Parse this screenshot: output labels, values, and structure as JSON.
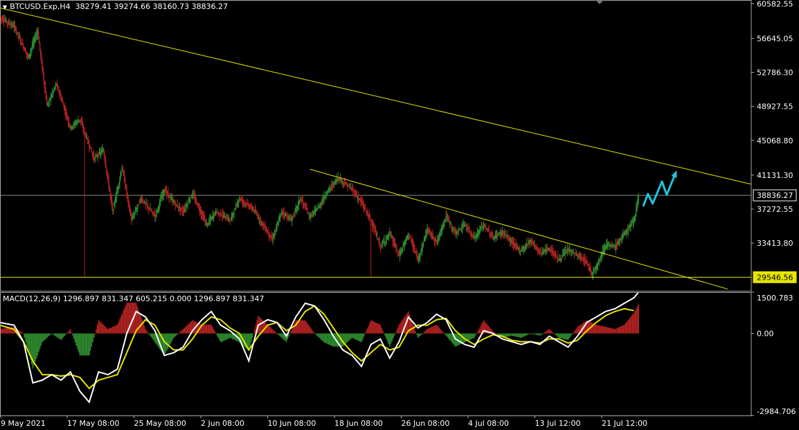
{
  "header": {
    "symbol": "BTCUSD.Exp,H4",
    "ohlc": "38279.41 39274.66 38160.73 38836.27"
  },
  "macd_header": "MACD(12,26,9) 1296.897 831.347 605.215 0.000 1296.897 831.347",
  "colors": {
    "background": "#000000",
    "bull": "#2e8b2e",
    "bear": "#b22222",
    "trendline": "#e6e600",
    "arrow": "#1fc4d8",
    "macd_line": "#ffffff",
    "signal_line": "#e6e600"
  },
  "chart_data": [
    {
      "type": "candlestick",
      "price_ticks": [
        "60582.55",
        "56645.05",
        "52786.30",
        "48927.55",
        "45068.80",
        "41131.30",
        "37272.55",
        "33413.80"
      ],
      "current_price_label": "38836.27",
      "support_label": "29546.56",
      "time_ticks": [
        "9 May 2021",
        "17 May 08:00",
        "25 May 08:00",
        "2 Jun 08:00",
        "10 Jun 08:00",
        "18 Jun 08:00",
        "26 Jun 08:00",
        "4 Jul 08:00",
        "13 Jul 12:00",
        "21 Jul 12:00"
      ],
      "ylim": [
        28000,
        61000
      ],
      "current_price": 38836.27,
      "support_level": 29546.56,
      "price_path": [
        [
          0,
          59000
        ],
        [
          3,
          58000
        ],
        [
          6,
          54500
        ],
        [
          8,
          57500
        ],
        [
          10,
          49000
        ],
        [
          12,
          51500
        ],
        [
          15,
          46500
        ],
        [
          17,
          47500
        ],
        [
          20,
          43000
        ],
        [
          22,
          44000
        ],
        [
          24,
          37000
        ],
        [
          26,
          42000
        ],
        [
          28,
          36000
        ],
        [
          30,
          38500
        ],
        [
          33,
          36500
        ],
        [
          35,
          39500
        ],
        [
          37,
          38000
        ],
        [
          39,
          37000
        ],
        [
          41,
          39000
        ],
        [
          44,
          35500
        ],
        [
          46,
          37000
        ],
        [
          49,
          36000
        ],
        [
          51,
          38500
        ],
        [
          54,
          37200
        ],
        [
          56,
          35500
        ],
        [
          58,
          33800
        ],
        [
          60,
          37000
        ],
        [
          62,
          36000
        ],
        [
          64,
          38500
        ],
        [
          66,
          36400
        ],
        [
          68,
          37600
        ],
        [
          70,
          39500
        ],
        [
          72,
          40800
        ],
        [
          75,
          39500
        ],
        [
          77,
          38000
        ],
        [
          79,
          36000
        ],
        [
          81,
          33000
        ],
        [
          83,
          34500
        ],
        [
          85,
          32000
        ],
        [
          87,
          34500
        ],
        [
          89,
          31500
        ],
        [
          91,
          35000
        ],
        [
          93,
          33500
        ],
        [
          95,
          36500
        ],
        [
          97,
          34500
        ],
        [
          99,
          35500
        ],
        [
          101,
          34000
        ],
        [
          103,
          35500
        ],
        [
          105,
          34000
        ],
        [
          107,
          34700
        ],
        [
          109,
          33500
        ],
        [
          111,
          32500
        ],
        [
          113,
          33800
        ],
        [
          115,
          32300
        ],
        [
          117,
          32800
        ],
        [
          119,
          31500
        ],
        [
          121,
          32700
        ],
        [
          123,
          32000
        ],
        [
          125,
          31200
        ],
        [
          126,
          29900
        ],
        [
          127,
          30800
        ],
        [
          129,
          33200
        ],
        [
          131,
          33000
        ],
        [
          133,
          34500
        ],
        [
          135,
          36000
        ],
        [
          136,
          38836
        ]
      ],
      "support_low_points": [
        {
          "index": 18,
          "low": 29600
        },
        {
          "index": 79,
          "low": 29500
        },
        {
          "index": 126,
          "low": 29600
        }
      ],
      "trendlines": [
        {
          "name": "upper",
          "start": [
            0,
            60100
          ],
          "end": [
            160,
            40100
          ]
        },
        {
          "name": "lower",
          "start": [
            66,
            41800
          ],
          "end": [
            155,
            28200
          ]
        },
        {
          "name": "support",
          "start": [
            0,
            29546.56
          ],
          "end": [
            160,
            29546.56
          ]
        }
      ],
      "forecast_arrow": [
        [
          137,
          37600
        ],
        [
          138,
          39000
        ],
        [
          139,
          37900
        ],
        [
          141,
          40400
        ],
        [
          142,
          38900
        ],
        [
          144,
          41500
        ]
      ]
    },
    {
      "type": "macd",
      "params": "MACD(12,26,9)",
      "y_ticks": [
        "1500.783",
        "0.00",
        "-2984.706"
      ],
      "ylim": [
        -2984.706,
        1500.783
      ],
      "last_values": {
        "macd": 1296.897,
        "signal": 831.347
      },
      "macd_path": [
        [
          0,
          400
        ],
        [
          3,
          300
        ],
        [
          5,
          -300
        ],
        [
          7,
          -1800
        ],
        [
          9,
          -1700
        ],
        [
          11,
          -1500
        ],
        [
          13,
          -1700
        ],
        [
          15,
          -1400
        ],
        [
          17,
          -2100
        ],
        [
          19,
          -2500
        ],
        [
          21,
          -1400
        ],
        [
          23,
          -1500
        ],
        [
          25,
          -1300
        ],
        [
          27,
          0
        ],
        [
          29,
          800
        ],
        [
          31,
          600
        ],
        [
          33,
          100
        ],
        [
          35,
          -800
        ],
        [
          37,
          -700
        ],
        [
          39,
          -500
        ],
        [
          41,
          100
        ],
        [
          43,
          500
        ],
        [
          45,
          800
        ],
        [
          47,
          300
        ],
        [
          49,
          100
        ],
        [
          51,
          -200
        ],
        [
          53,
          -1000
        ],
        [
          55,
          300
        ],
        [
          57,
          500
        ],
        [
          59,
          400
        ],
        [
          61,
          -100
        ],
        [
          63,
          600
        ],
        [
          65,
          1100
        ],
        [
          67,
          1000
        ],
        [
          69,
          500
        ],
        [
          71,
          -100
        ],
        [
          73,
          -600
        ],
        [
          75,
          -800
        ],
        [
          77,
          -1200
        ],
        [
          79,
          -400
        ],
        [
          81,
          -200
        ],
        [
          83,
          -900
        ],
        [
          85,
          -300
        ],
        [
          87,
          600
        ],
        [
          89,
          200
        ],
        [
          91,
          400
        ],
        [
          93,
          700
        ],
        [
          95,
          500
        ],
        [
          97,
          -200
        ],
        [
          99,
          -400
        ],
        [
          101,
          -500
        ],
        [
          103,
          100
        ],
        [
          105,
          0
        ],
        [
          107,
          -200
        ],
        [
          109,
          -300
        ],
        [
          111,
          -400
        ],
        [
          113,
          -300
        ],
        [
          115,
          -400
        ],
        [
          117,
          -100
        ],
        [
          119,
          -300
        ],
        [
          121,
          -500
        ],
        [
          123,
          -100
        ],
        [
          125,
          400
        ],
        [
          127,
          600
        ],
        [
          129,
          800
        ],
        [
          131,
          900
        ],
        [
          133,
          1100
        ],
        [
          135,
          1296.9
        ],
        [
          136,
          1500
        ]
      ],
      "signal_path": [
        [
          0,
          300
        ],
        [
          3,
          150
        ],
        [
          5,
          -300
        ],
        [
          7,
          -1000
        ],
        [
          9,
          -1500
        ],
        [
          11,
          -1500
        ],
        [
          13,
          -1550
        ],
        [
          15,
          -1500
        ],
        [
          17,
          -1600
        ],
        [
          19,
          -2000
        ],
        [
          21,
          -1700
        ],
        [
          23,
          -1600
        ],
        [
          25,
          -1500
        ],
        [
          27,
          -700
        ],
        [
          29,
          100
        ],
        [
          31,
          500
        ],
        [
          33,
          300
        ],
        [
          35,
          -300
        ],
        [
          37,
          -600
        ],
        [
          39,
          -600
        ],
        [
          41,
          -200
        ],
        [
          43,
          300
        ],
        [
          45,
          600
        ],
        [
          47,
          500
        ],
        [
          49,
          200
        ],
        [
          51,
          0
        ],
        [
          53,
          -600
        ],
        [
          55,
          -100
        ],
        [
          57,
          300
        ],
        [
          59,
          400
        ],
        [
          61,
          100
        ],
        [
          63,
          300
        ],
        [
          65,
          800
        ],
        [
          67,
          1000
        ],
        [
          69,
          700
        ],
        [
          71,
          200
        ],
        [
          73,
          -300
        ],
        [
          75,
          -700
        ],
        [
          77,
          -1000
        ],
        [
          79,
          -700
        ],
        [
          81,
          -400
        ],
        [
          83,
          -600
        ],
        [
          85,
          -500
        ],
        [
          87,
          100
        ],
        [
          89,
          300
        ],
        [
          91,
          300
        ],
        [
          93,
          500
        ],
        [
          95,
          550
        ],
        [
          97,
          100
        ],
        [
          99,
          -200
        ],
        [
          101,
          -400
        ],
        [
          103,
          -200
        ],
        [
          105,
          -50
        ],
        [
          107,
          -100
        ],
        [
          109,
          -250
        ],
        [
          111,
          -300
        ],
        [
          113,
          -300
        ],
        [
          115,
          -350
        ],
        [
          117,
          -200
        ],
        [
          119,
          -200
        ],
        [
          121,
          -350
        ],
        [
          123,
          -250
        ],
        [
          125,
          100
        ],
        [
          127,
          400
        ],
        [
          129,
          650
        ],
        [
          131,
          800
        ],
        [
          133,
          900
        ],
        [
          135,
          831.3
        ]
      ]
    }
  ]
}
